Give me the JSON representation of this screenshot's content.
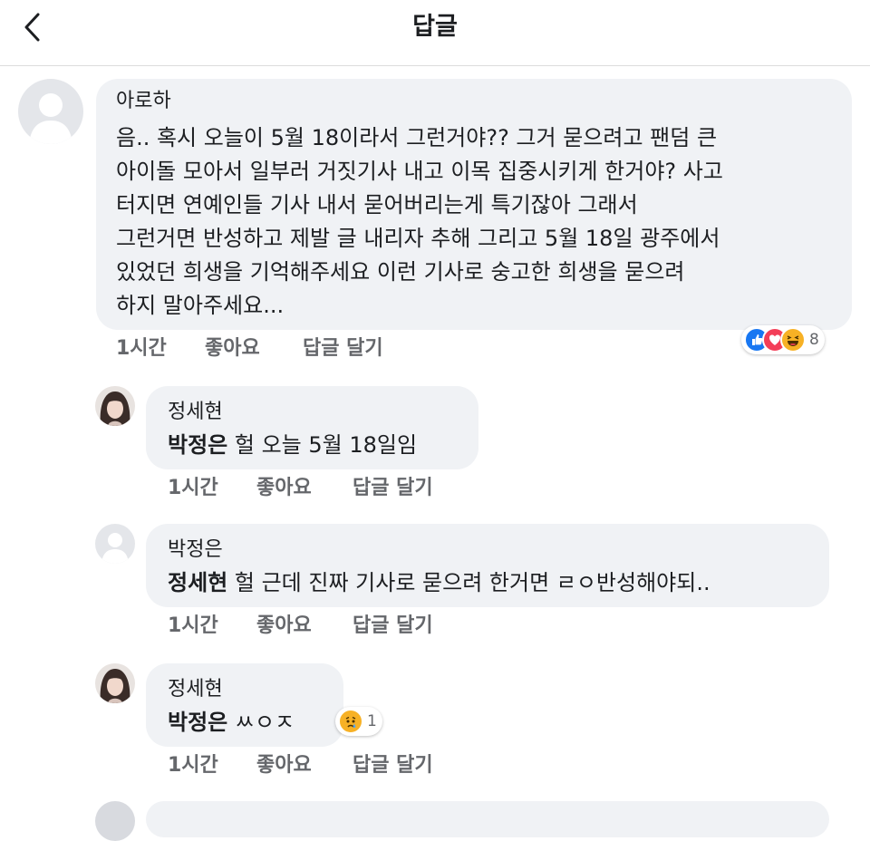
{
  "header": {
    "title": "답글"
  },
  "comments": [
    {
      "author": "아로하",
      "lines": [
        "음.. 혹시 오늘이 5월 18이라서 그런거야?? 그거 묻으려고 팬덤 큰",
        "아이돌 모아서 일부러 거짓기사 내고 이목 집중시키게 한거야? 사고",
        "터지면 연예인들 기사 내서 묻어버리는게 특기잖아 그래서",
        "그런거면 반성하고 제발 글 내리자 추해 그리고 5월 18일 광주에서",
        "있었던 희생을 기억해주세요 이런 기사로 숭고한 희생을 묻으려",
        "하지 말아주세요..."
      ],
      "time": "1시간",
      "like": "좋아요",
      "reply": "답글 달기",
      "reaction_icons": [
        "like-reaction-icon",
        "love-reaction-icon",
        "haha-reaction-icon"
      ],
      "reaction_count": "8"
    },
    {
      "author": "정세현",
      "mention": "박정은",
      "text": " 헐 오늘 5월 18일임",
      "time": "1시간",
      "like": "좋아요",
      "reply": "답글 달기"
    },
    {
      "author": "박정은",
      "mention": "정세현",
      "text": " 헐 근데 진짜 기사로 묻으려 한거면 ㄹㅇ반성해야되..",
      "time": "1시간",
      "like": "좋아요",
      "reply": "답글 달기"
    },
    {
      "author": "정세현",
      "mention": "박정은",
      "text": " ㅆㅇㅈ",
      "time": "1시간",
      "like": "좋아요",
      "reply": "답글 달기",
      "reaction_icons": [
        "sad-reaction-icon"
      ],
      "reaction_count": "1"
    }
  ],
  "colors": {
    "bubble": "#f0f2f5",
    "meta": "#65676b",
    "like_blue": "#1877f2",
    "love_red": "#f33e58",
    "haha_yellow": "#f7b125"
  }
}
